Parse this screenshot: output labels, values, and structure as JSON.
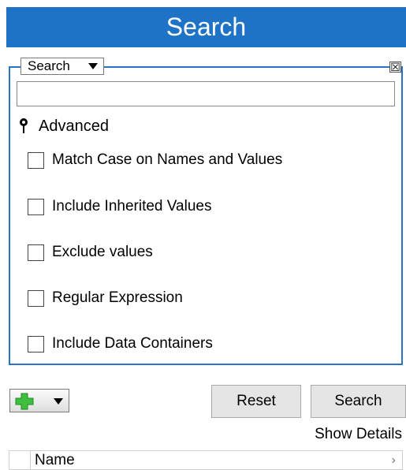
{
  "header": {
    "title": "Search"
  },
  "scope_dropdown": {
    "value": "Search"
  },
  "close_glyph": "☒",
  "search": {
    "value": "",
    "placeholder": ""
  },
  "advanced": {
    "label": "Advanced"
  },
  "options": [
    {
      "label": "Match Case on Names and Values",
      "checked": false
    },
    {
      "label": "Include Inherited Values",
      "checked": false
    },
    {
      "label": "Exclude values",
      "checked": false
    },
    {
      "label": "Regular Expression",
      "checked": false
    },
    {
      "label": "Include Data Containers",
      "checked": false
    }
  ],
  "buttons": {
    "reset": "Reset",
    "search": "Search"
  },
  "show_details": "Show Details",
  "table": {
    "columns": [
      "Name"
    ],
    "chevron": "›"
  },
  "colors": {
    "header_bg": "#1f73c7",
    "panel_border": "#2a74c6",
    "add_icon": "#3fbf3f"
  }
}
